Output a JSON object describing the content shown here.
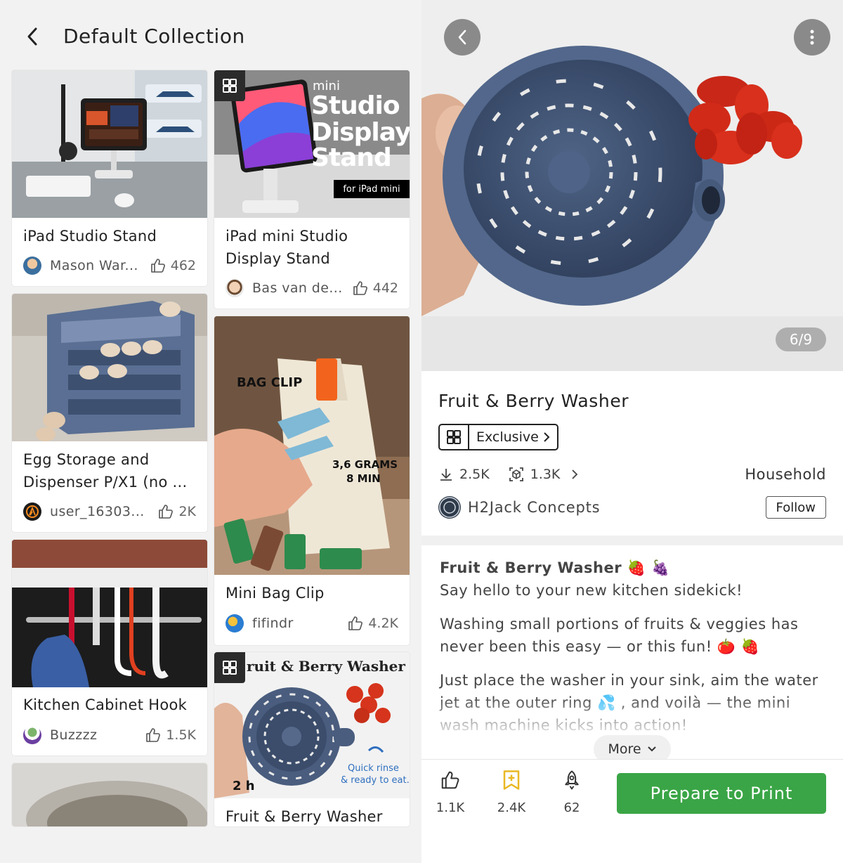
{
  "left": {
    "title": "Default Collection",
    "cards": [
      {
        "title": "iPad Studio Stand",
        "author": "Mason War...",
        "likes": "462"
      },
      {
        "title": "iPad mini Studio Display Stand",
        "title_l1": "iPad mini Studio",
        "title_l2": "Display Stand",
        "author": "Bas van de...",
        "likes": "442",
        "thumb_text": {
          "mini": "mini",
          "l1": "Studio",
          "l2": "Display",
          "l3": "Stand",
          "tag": "for iPad mini"
        }
      },
      {
        "title_l1": "Egg Storage and",
        "title_l2": "Dispenser P/X1 (no ...",
        "author": "user_16303...",
        "likes": "2K"
      },
      {
        "title": "Mini Bag Clip",
        "author": "fifindr",
        "likes": "4.2K",
        "thumb_text": {
          "clip": "BAG CLIP",
          "grams": "3,6 GRAMS",
          "min": "8 MIN"
        }
      },
      {
        "title": "Kitchen Cabinet Hook",
        "author": "Buzzzz",
        "likes": "1.5K"
      },
      {
        "title": "Fruit & Berry Washer",
        "thumb_text": {
          "banner": "ruit & Berry Washer",
          "rinse1": "Quick rinse",
          "rinse2": "& ready to eat.",
          "time": "2 h"
        }
      }
    ]
  },
  "right": {
    "pager": "6/9",
    "title": "Fruit & Berry Washer",
    "exclusive_label": "Exclusive",
    "downloads": "2.5K",
    "prints": "1.3K",
    "category": "Household",
    "author": "H2Jack Concepts",
    "follow_label": "Follow",
    "desc_heading": "Fruit & Berry Washer 🍓 🍇",
    "desc_l1": "Say hello to your new kitchen sidekick!",
    "desc_p2": "Washing small portions of fruits & veggies has never been this easy — or this fun! 🍅 🍓",
    "desc_p3": "Just place the washer in your sink, aim the water jet at the outer ring 💦 , and voilà — the mini wash machine kicks into action!",
    "more_label": "More",
    "likes": "1.1K",
    "collects": "2.4K",
    "boosts": "62",
    "print_label": "Prepare to Print"
  },
  "colors": {
    "accent": "#3aa546",
    "collect": "#e9b824",
    "washer": "#4a5d7e"
  }
}
